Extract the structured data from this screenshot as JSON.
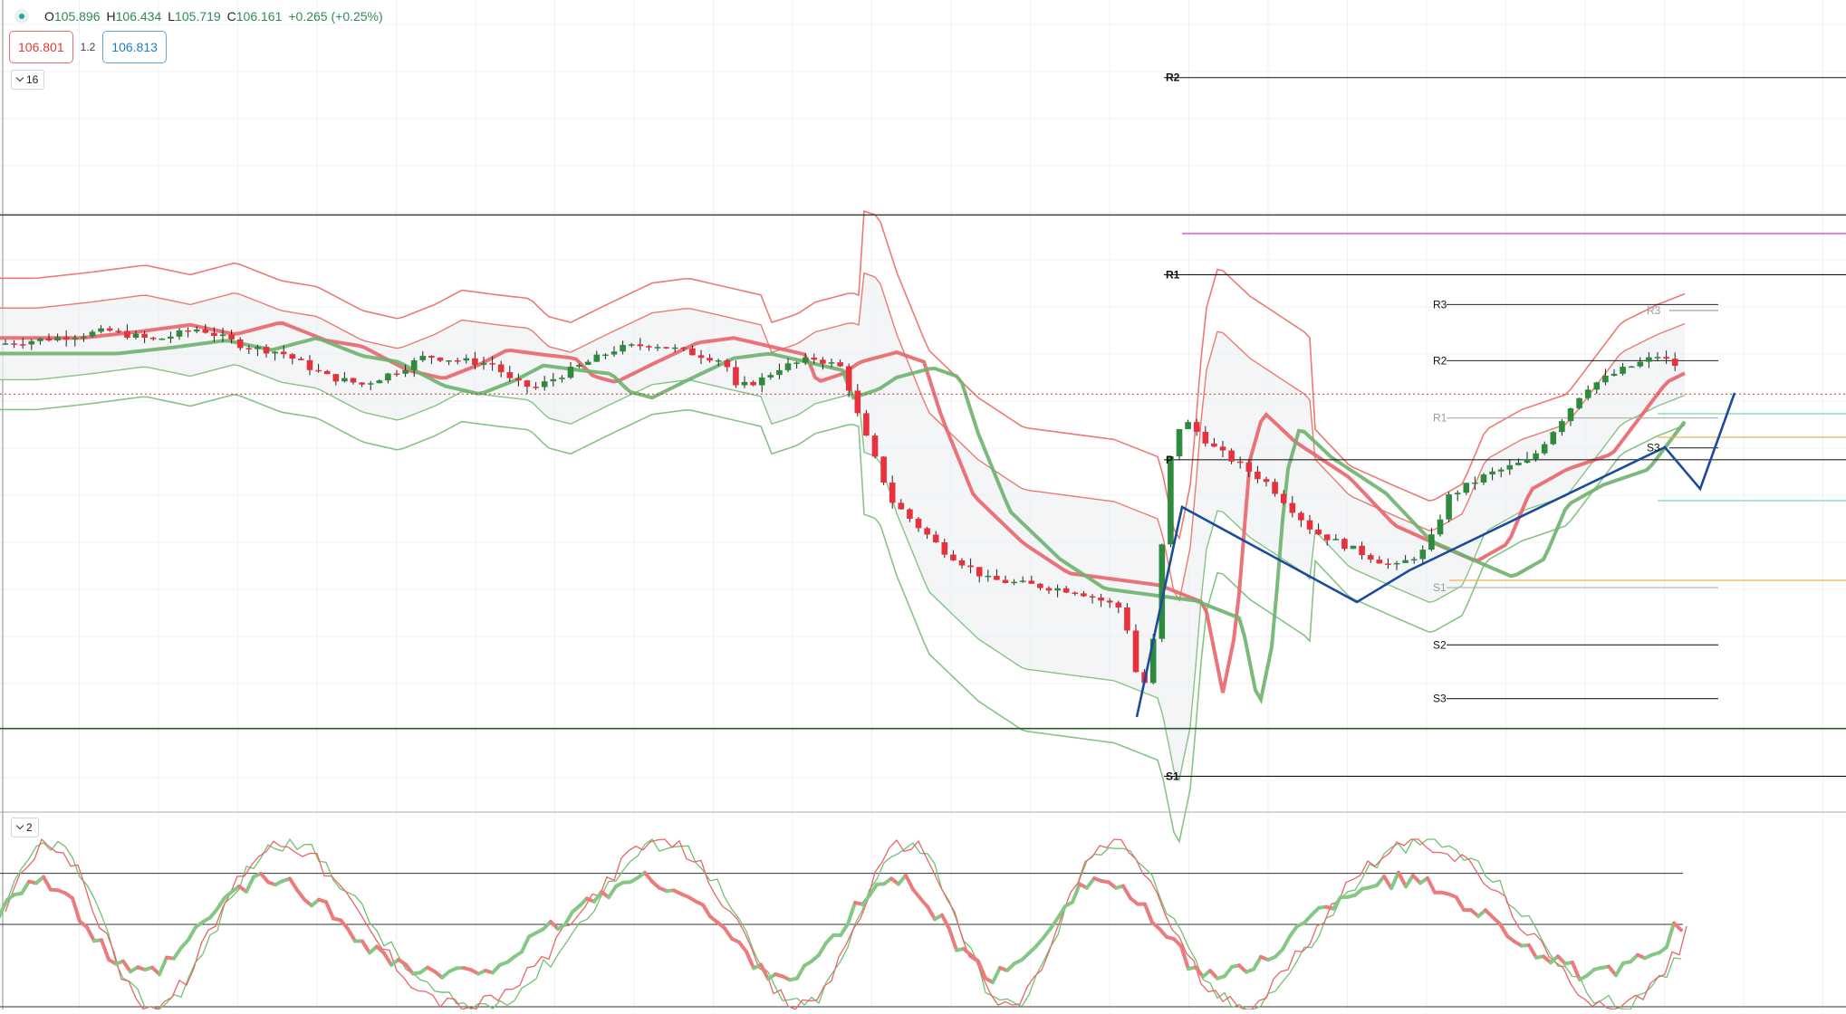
{
  "header": {
    "ohlc": {
      "open_key": "O",
      "open": "105.896",
      "high_key": "H",
      "high": "106.434",
      "low_key": "L",
      "low": "105.719",
      "close_key": "C",
      "close": "106.161",
      "change": "+0.265 (+0.25%)"
    }
  },
  "trade": {
    "sell": "106.801",
    "spread": "1.2",
    "buy": "106.813"
  },
  "panes": {
    "main_label": "16",
    "oscillator_label": "2"
  },
  "chart_data": [
    {
      "type": "candlestick",
      "ylim": [
        103.0,
        109.8
      ],
      "grid": true,
      "current_price": 106.5,
      "horizontal_lines": [
        108.0,
        103.7,
        106.5
      ],
      "pivot_levels": [
        {
          "label": "R2",
          "value": 109.15
        },
        {
          "label": "R1",
          "value": 107.5
        },
        {
          "label": "S1",
          "value": 103.3
        },
        {
          "label": "R3",
          "value": 107.25
        },
        {
          "label": "R2",
          "value": 106.78
        },
        {
          "label": "R1",
          "value": 106.3
        },
        {
          "label": "P",
          "value": 105.95
        },
        {
          "label": "S1",
          "value": 104.88
        },
        {
          "label": "S2",
          "value": 104.4
        },
        {
          "label": "S3",
          "value": 103.95
        },
        {
          "label": "R3",
          "value": 107.2
        },
        {
          "label": "S3",
          "value": 106.05
        }
      ],
      "colors": {
        "up": "#2e8b3e",
        "down": "#e8313c",
        "band_upper": "#ec7a72",
        "band_lower": "#86c386",
        "zigzag": "#1c4a9c",
        "magenta": "#d65bd6",
        "orange": "#f2b05a",
        "mint": "#8fe0b4"
      }
    },
    {
      "type": "line",
      "series": [
        {
          "values": []
        },
        {
          "values": []
        },
        {
          "values": []
        },
        {
          "values": []
        }
      ],
      "levels": [
        80,
        50
      ]
    }
  ]
}
